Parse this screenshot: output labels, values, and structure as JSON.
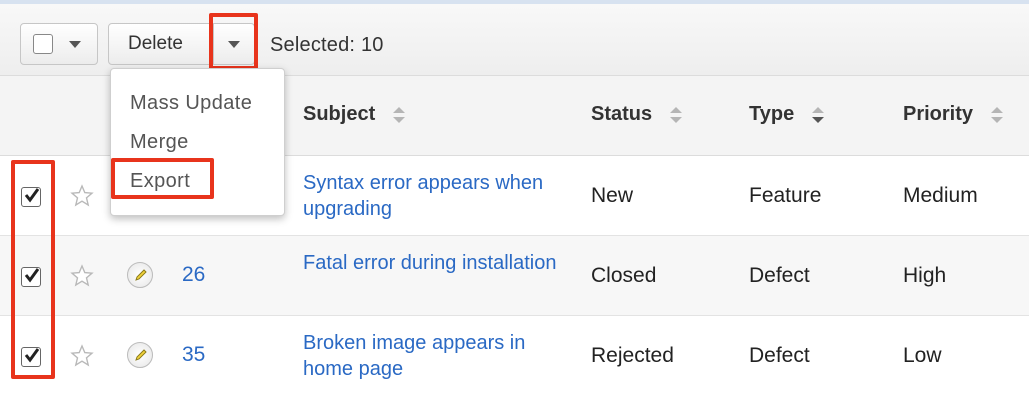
{
  "toolbar": {
    "delete_label": "Delete",
    "selected_label": "Selected:",
    "selected_count": "10"
  },
  "actions_menu": {
    "items": [
      "Mass Update",
      "Merge",
      "Export"
    ]
  },
  "table": {
    "columns": [
      "Subject",
      "Status",
      "Type",
      "Priority"
    ],
    "rows": [
      {
        "number": "",
        "subject": "Syntax error appears when upgrading",
        "status": "New",
        "type": "Feature",
        "priority": "Medium",
        "checked": true
      },
      {
        "number": "26",
        "subject": "Fatal error during installation",
        "status": "Closed",
        "type": "Defect",
        "priority": "High",
        "checked": true
      },
      {
        "number": "35",
        "subject": "Broken image appears in home page",
        "status": "Rejected",
        "type": "Defect",
        "priority": "Low",
        "checked": true
      }
    ]
  },
  "colors": {
    "link": "#2a69c4",
    "highlight": "#e8341c",
    "header_bg": "#f4f4f4"
  },
  "icons": [
    "checkbox-icon",
    "caret-down-icon",
    "star-icon",
    "pencil-icon",
    "sort-icon"
  ]
}
